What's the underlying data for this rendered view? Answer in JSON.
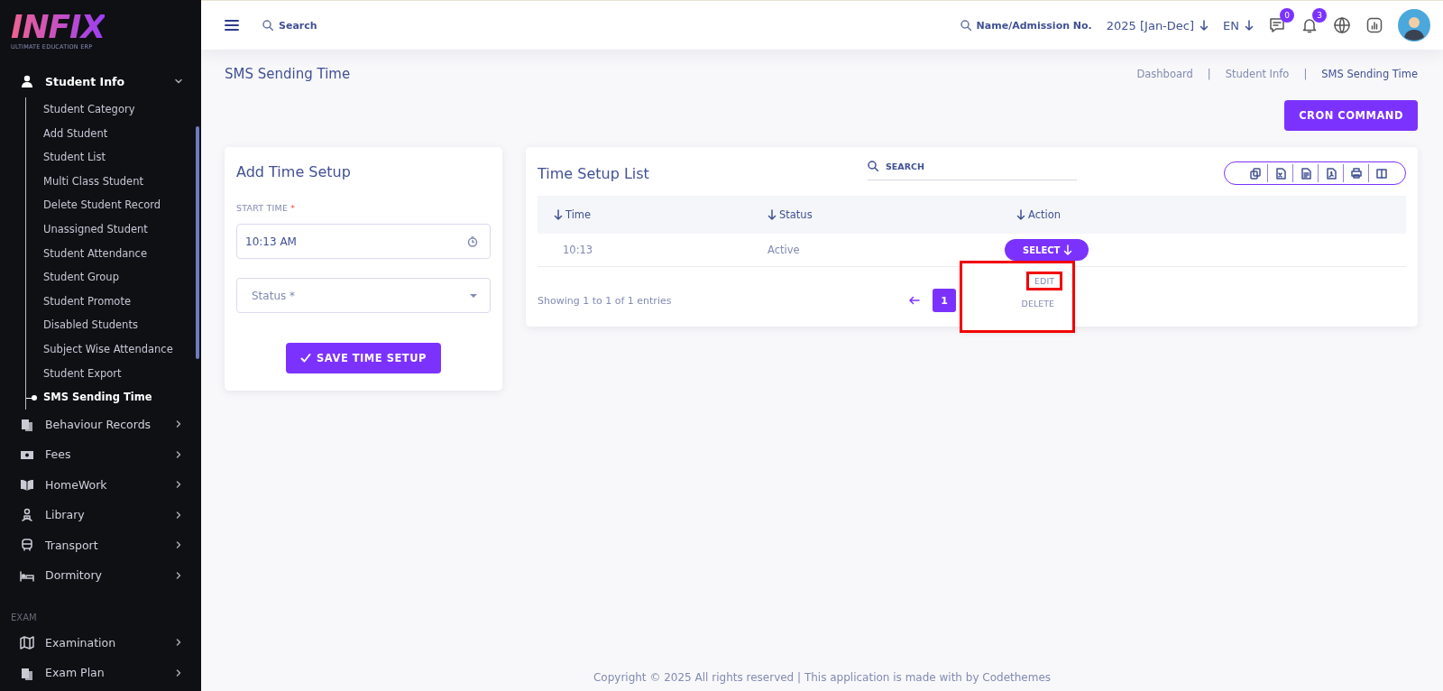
{
  "sidebar": {
    "logo": {
      "title": "INFIX",
      "subtitle": "ULTIMATE EDUCATION ERP"
    },
    "items": [
      {
        "label": "Student Info",
        "expanded": true,
        "children": [
          {
            "label": "Student Category",
            "selected": false
          },
          {
            "label": "Add Student",
            "selected": false
          },
          {
            "label": "Student List",
            "selected": false
          },
          {
            "label": "Multi Class Student",
            "selected": false
          },
          {
            "label": "Delete Student Record",
            "selected": false
          },
          {
            "label": "Unassigned Student",
            "selected": false
          },
          {
            "label": "Student Attendance",
            "selected": false
          },
          {
            "label": "Student Group",
            "selected": false
          },
          {
            "label": "Student Promote",
            "selected": false
          },
          {
            "label": "Disabled Students",
            "selected": false
          },
          {
            "label": "Subject Wise Attendance",
            "selected": false
          },
          {
            "label": "Student Export",
            "selected": false
          },
          {
            "label": "SMS Sending Time",
            "selected": true
          }
        ]
      },
      {
        "label": "Behaviour Records",
        "expanded": false
      },
      {
        "label": "Fees",
        "expanded": false
      },
      {
        "label": "HomeWork",
        "expanded": false
      },
      {
        "label": "Library",
        "expanded": false
      },
      {
        "label": "Transport",
        "expanded": false
      },
      {
        "label": "Dormitory",
        "expanded": false
      }
    ],
    "section": "EXAM",
    "section_items": [
      {
        "label": "Examination",
        "expanded": false
      },
      {
        "label": "Exam Plan",
        "expanded": false
      }
    ]
  },
  "header": {
    "search_placeholder": "Search",
    "student_search_placeholder": "Name/Admission No.",
    "session": "2025 [Jan-Dec]",
    "language": "EN",
    "messages_badge": "0",
    "notifications_badge": "3"
  },
  "page": {
    "title": "SMS Sending Time",
    "breadcrumb_separator": "|",
    "breadcrumbs": [
      {
        "label": "Dashboard",
        "current": false
      },
      {
        "label": "Student Info",
        "current": false
      },
      {
        "label": "SMS Sending Time",
        "current": true
      }
    ],
    "action_button": "CRON COMMAND"
  },
  "form": {
    "title": "Add Time Setup",
    "start_time_label": "START TIME",
    "required_mark": "*",
    "start_time_value": "10:13 AM",
    "status_placeholder": "Status *",
    "save_button": "SAVE TIME SETUP"
  },
  "list": {
    "title": "Time Setup List",
    "search_placeholder": "SEARCH",
    "export_buttons": [
      {
        "kind": "copy"
      },
      {
        "kind": "excel"
      },
      {
        "kind": "csv"
      },
      {
        "kind": "pdf"
      },
      {
        "kind": "print"
      },
      {
        "kind": "columns"
      }
    ],
    "columns": [
      "Time",
      "Status",
      "Action"
    ],
    "rows": [
      {
        "time": "10:13",
        "status": "Active",
        "action": "SELECT",
        "menu_open": true
      }
    ],
    "menu": {
      "highlighted": true,
      "items": [
        {
          "label": "EDIT",
          "highlighted": true
        },
        {
          "label": "DELETE",
          "highlighted": false
        }
      ]
    },
    "entries": "Showing 1 to 1 of 1 entries",
    "pages": [
      {
        "label": "1",
        "selected": true
      }
    ]
  },
  "footer": "Copyright © 2025 All rights reserved | This application is made with by Codethemes"
}
